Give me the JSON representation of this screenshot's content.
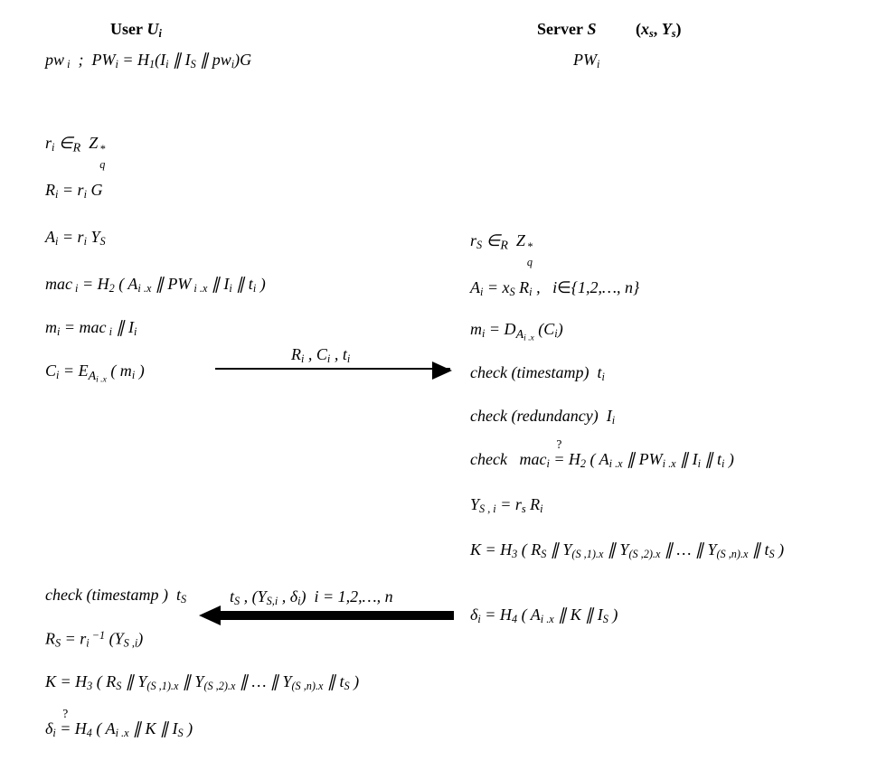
{
  "heading": {
    "user": "User Uᵢ",
    "server": "Server S",
    "server_keys": "(xₛ, Yₛ)"
  },
  "user": {
    "pw": "pwᵢ   ;   PWᵢ = H₁(Iᵢ ∥ I_S ∥ pwᵢ) G",
    "ri": "rᵢ ∈_R  Z*_q",
    "Ri": "Rᵢ = rᵢ G",
    "Ai": "Aᵢ = rᵢ Y_S",
    "mac": "macᵢ = H₂ ( Aᵢ.x ∥ PWᵢ.x ∥ Iᵢ ∥ tᵢ )",
    "mi": "mᵢ = macᵢ ∥ Iᵢ",
    "Ci": "Cᵢ = E_{Aᵢ.x} ( mᵢ )",
    "chk_ts": "check (timestamp) t_S",
    "RS": "R_S = rᵢ⁻¹ (Y_{S,i})",
    "K": "K = H₃ ( R_S ∥ Y_{(S,1).x} ∥ Y_{(S,2).x} ∥ … ∥ Y_{(S,n).x} ∥ t_S )",
    "delta": "δᵢ =? H₄ ( Aᵢ.x ∥ K ∥ I_S )"
  },
  "server": {
    "PW": "PWᵢ",
    "rs": "r_S ∈_R  Z*_q",
    "Ai": "Aᵢ = x_S Rᵢ ,   i ∈ {1,2,…,n}",
    "mi": "mᵢ = D_{Aᵢ.x} (Cᵢ)",
    "chk_ts": "check (timestamp)  tᵢ",
    "chk_red": "check (redundancy)  Iᵢ",
    "chk_mac": "check   macᵢ =? H₂ ( Aᵢ.x ∥ PWᵢ.x ∥ Iᵢ ∥ tᵢ )",
    "Ysi": "Y_{S,i} = r_s Rᵢ",
    "K": "K = H₃ ( R_S ∥ Y_{(S,1).x} ∥ Y_{(S,2).x} ∥ … ∥ Y_{(S,n).x} ∥ t_S )",
    "delta": "δᵢ = H₄ ( Aᵢ.x ∥ K ∥ I_S )"
  },
  "msg1": "Rᵢ , Cᵢ , tᵢ",
  "msg2": "t_S , (Y_{S,i} , δᵢ)  i = 1,2,…, n"
}
